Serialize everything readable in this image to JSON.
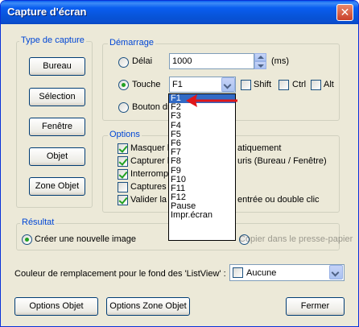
{
  "window": {
    "title": "Capture d'écran",
    "close_glyph": "✕"
  },
  "capture_type": {
    "legend": "Type de capture",
    "buttons": [
      "Bureau",
      "Sélection",
      "Fenêtre",
      "Objet",
      "Zone Objet"
    ]
  },
  "startup": {
    "legend": "Démarrage",
    "delay_label": "Délai",
    "delay_value": "1000",
    "delay_unit": "(ms)",
    "key_label": "Touche",
    "key_value": "F1",
    "shift_label": "Shift",
    "ctrl_label": "Ctrl",
    "alt_label": "Alt",
    "button_label": "Bouton dro",
    "selected": "key"
  },
  "key_options": [
    "F1",
    "F2",
    "F3",
    "F4",
    "F5",
    "F6",
    "F7",
    "F8",
    "F9",
    "F10",
    "F11",
    "F12",
    "Pause",
    "Impr.écran"
  ],
  "options": {
    "legend": "Options",
    "items": [
      {
        "label": "Masquer l",
        "tail": "atiquement",
        "checked": true
      },
      {
        "label": "Capturer le",
        "tail": "uris (Bureau / Fenêtre)",
        "checked": true
      },
      {
        "label": "Interrompr",
        "tail": "",
        "checked": true
      },
      {
        "label": "Captures m",
        "tail": "",
        "checked": false
      },
      {
        "label": "Valider la s",
        "tail": "entrée ou double clic",
        "checked": true
      }
    ]
  },
  "result": {
    "legend": "Résultat",
    "new_image_label": "Créer une nouvelle image",
    "clipboard_label": "Copier dans le presse-papier",
    "selected": "new_image"
  },
  "listview": {
    "label": "Couleur de remplacement pour le fond des 'ListView' :",
    "value": "Aucune"
  },
  "footer": {
    "options_object": "Options Objet",
    "options_zone": "Options Zone Objet",
    "close": "Fermer"
  },
  "colors": {
    "accent": "#0046d5",
    "arrow": "#e0161a",
    "title_bar": "#0a5ef0"
  }
}
